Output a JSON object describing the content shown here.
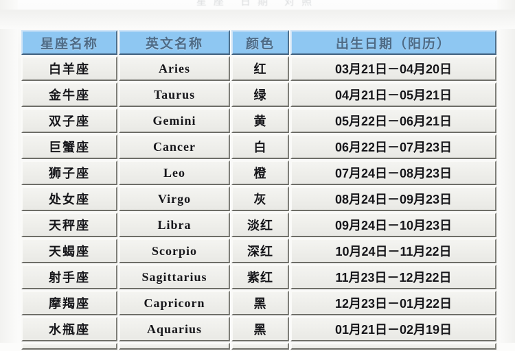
{
  "page": {
    "top_clipped_heading": "星座 日期 对照"
  },
  "table": {
    "name": "zodiac-reference-table",
    "columns": [
      {
        "key": "cn",
        "label": "星座名称"
      },
      {
        "key": "en",
        "label": "英文名称"
      },
      {
        "key": "color",
        "label": "颜色"
      },
      {
        "key": "date",
        "label": "出生日期（阳历）"
      }
    ],
    "rows": [
      {
        "cn": "白羊座",
        "en": "Aries",
        "color": "红",
        "date": "03月21日－04月20日"
      },
      {
        "cn": "金牛座",
        "en": "Taurus",
        "color": "绿",
        "date": "04月21日－05月21日"
      },
      {
        "cn": "双子座",
        "en": "Gemini",
        "color": "黄",
        "date": "05月22日－06月21日"
      },
      {
        "cn": "巨蟹座",
        "en": "Cancer",
        "color": "白",
        "date": "06月22日－07月23日"
      },
      {
        "cn": "狮子座",
        "en": "Leo",
        "color": "橙",
        "date": "07月24日－08月23日"
      },
      {
        "cn": "处女座",
        "en": "Virgo",
        "color": "灰",
        "date": "08月24日－09月23日"
      },
      {
        "cn": "天秤座",
        "en": "Libra",
        "color": "淡红",
        "date": "09月24日－10月23日"
      },
      {
        "cn": "天蝎座",
        "en": "Scorpio",
        "color": "深红",
        "date": "10月24日－11月22日"
      },
      {
        "cn": "射手座",
        "en": "Sagittarius",
        "color": "紫红",
        "date": "11月23日－12月22日"
      },
      {
        "cn": "摩羯座",
        "en": "Capricorn",
        "color": "黑",
        "date": "12月23日－01月22日"
      },
      {
        "cn": "水瓶座",
        "en": "Aquarius",
        "color": "黑",
        "date": "01月21日－02月19日"
      }
    ]
  },
  "colors": {
    "header_fill": "#8ec7f2",
    "header_text": "#4e6b86",
    "header_border_light": "#cfe4f7",
    "header_border_dark": "#3f5f7d",
    "cell_fill": "#f0f0ec",
    "cell_text": "#16161a",
    "cell_border_dark": "#6e6e68",
    "page_background": "#fbfbfa"
  }
}
